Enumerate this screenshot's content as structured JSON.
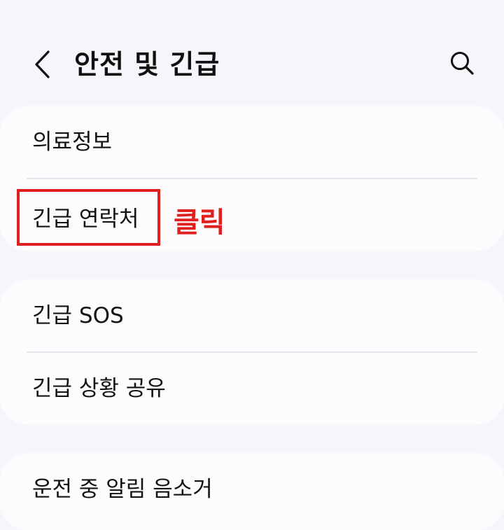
{
  "header": {
    "back_icon": "chevron-left-icon",
    "title": "안전 및 긴급",
    "search_icon": "search-icon"
  },
  "sections": [
    {
      "items": [
        {
          "label": "의료정보"
        },
        {
          "label": "긴급 연락처"
        }
      ]
    },
    {
      "items": [
        {
          "label": "긴급 SOS"
        },
        {
          "label": "긴급 상황 공유"
        }
      ]
    },
    {
      "items": [
        {
          "label": "운전 중 알림 음소거"
        }
      ]
    }
  ],
  "annotation": {
    "text": "클릭",
    "color": "#e0201e"
  }
}
